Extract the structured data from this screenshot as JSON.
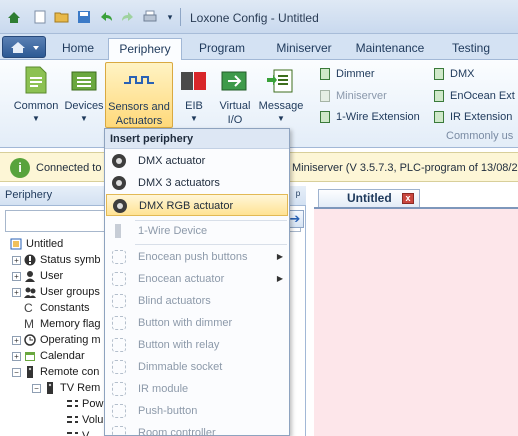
{
  "window": {
    "title": "Loxone Config - Untitled"
  },
  "tabs": [
    "Home",
    "Periphery",
    "Program",
    "Miniserver",
    "Maintenance",
    "Testing"
  ],
  "ribbon": {
    "buttons": {
      "common": "Common",
      "devices": "Devices",
      "sensors_line1": "Sensors and",
      "sensors_line2": "Actuators",
      "eib": "EIB",
      "virtual_line1": "Virtual",
      "virtual_line2": "I/O",
      "message": "Message"
    },
    "small_items_col1": [
      {
        "label": "Dimmer",
        "enabled": true
      },
      {
        "label": "Miniserver",
        "enabled": false
      },
      {
        "label": "1-Wire Extension",
        "enabled": true
      }
    ],
    "small_items_col2": [
      {
        "label": "DMX",
        "enabled": true
      },
      {
        "label": "EnOcean Ext",
        "enabled": true
      },
      {
        "label": "IR Extension",
        "enabled": true
      }
    ],
    "group_label": "Commonly us"
  },
  "infobar": {
    "left_text": "Connected to",
    "right_text": "Miniserver (V 3.5.7.3, PLC-program of 13/08/20"
  },
  "left_panel": {
    "header": "Periphery",
    "search_value": "",
    "tree": [
      {
        "label": "Untitled",
        "level": 0,
        "expander": ""
      },
      {
        "label": "Status symb",
        "level": 1,
        "expander": "+"
      },
      {
        "label": "User",
        "level": 1,
        "expander": "+"
      },
      {
        "label": "User groups",
        "level": 1,
        "expander": "+"
      },
      {
        "label": "Constants",
        "level": 1,
        "expander": ""
      },
      {
        "label": "Memory flag",
        "level": 1,
        "expander": ""
      },
      {
        "label": "Operating m",
        "level": 1,
        "expander": "+"
      },
      {
        "label": "Calendar",
        "level": 1,
        "expander": "+"
      },
      {
        "label": "Remote con",
        "level": 1,
        "expander": "−"
      },
      {
        "label": "TV Rem",
        "level": 2,
        "expander": "−"
      },
      {
        "label": "Pow",
        "level": 3,
        "expander": ""
      },
      {
        "label": "Volu",
        "level": 3,
        "expander": ""
      },
      {
        "label": "V",
        "level": 3,
        "expander": ""
      }
    ]
  },
  "document": {
    "tab_label": "Untitled",
    "close_label": "x"
  },
  "menu": {
    "header": "Insert periphery",
    "items": [
      {
        "label": "DMX actuator",
        "enabled": true,
        "highlight": false,
        "submenu": false
      },
      {
        "label": "DMX 3 actuators",
        "enabled": true,
        "highlight": false,
        "submenu": false
      },
      {
        "label": "DMX RGB actuator",
        "enabled": true,
        "highlight": true,
        "submenu": false
      },
      {
        "label": "1-Wire Device",
        "enabled": false,
        "highlight": false,
        "submenu": false
      },
      {
        "label": "Enocean push buttons",
        "enabled": false,
        "highlight": false,
        "submenu": true
      },
      {
        "label": "Enocean actuator",
        "enabled": false,
        "highlight": false,
        "submenu": true
      },
      {
        "label": "Blind actuators",
        "enabled": false,
        "highlight": false,
        "submenu": false
      },
      {
        "label": "Button with dimmer",
        "enabled": false,
        "highlight": false,
        "submenu": false
      },
      {
        "label": "Button with relay",
        "enabled": false,
        "highlight": false,
        "submenu": false
      },
      {
        "label": "Dimmable socket",
        "enabled": false,
        "highlight": false,
        "submenu": false
      },
      {
        "label": "IR module",
        "enabled": false,
        "highlight": false,
        "submenu": false
      },
      {
        "label": "Push-button",
        "enabled": false,
        "highlight": false,
        "submenu": false
      },
      {
        "label": "Room controller",
        "enabled": false,
        "highlight": false,
        "submenu": false
      }
    ]
  },
  "colors": {
    "accent": "#ffd97a",
    "info_bg": "#fdf6d6",
    "doc_bg": "#fde6ea"
  }
}
